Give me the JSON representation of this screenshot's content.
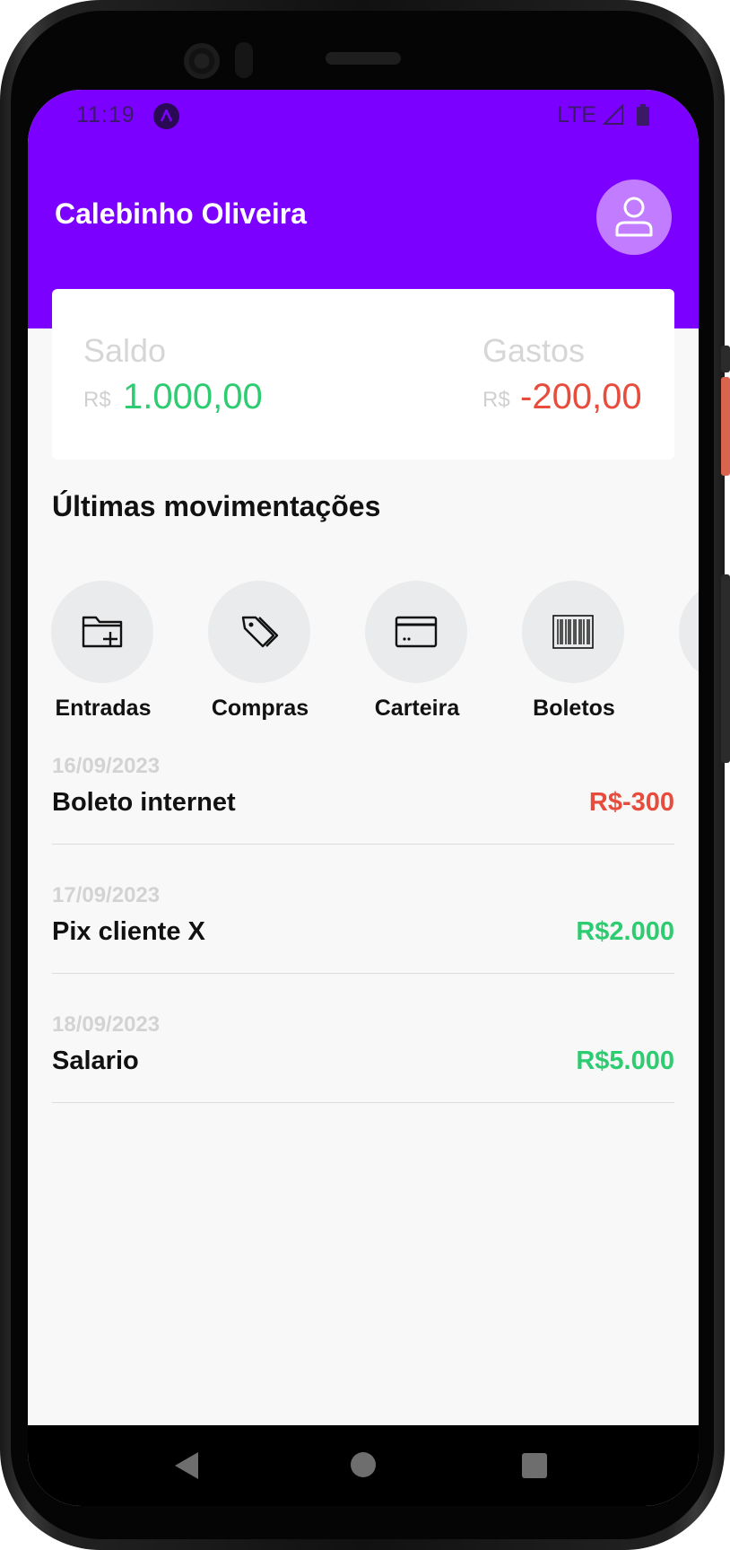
{
  "status_bar": {
    "time": "11:19",
    "network": "LTE",
    "icons": [
      "app-notification-icon",
      "signal-icon",
      "battery-icon"
    ]
  },
  "header": {
    "user_name": "Calebinho Oliveira",
    "avatar_icon": "user-icon"
  },
  "balance": {
    "saldo_label": "Saldo",
    "saldo_currency": "R$",
    "saldo_value": "1.000,00",
    "gastos_label": "Gastos",
    "gastos_currency": "R$",
    "gastos_value": "-200,00"
  },
  "section": {
    "title": "Últimas movimentações"
  },
  "actions": [
    {
      "label": "Entradas",
      "icon": "folder-add-icon"
    },
    {
      "label": "Compras",
      "icon": "tags-icon"
    },
    {
      "label": "Carteira",
      "icon": "credit-card-icon"
    },
    {
      "label": "Boletos",
      "icon": "barcode-icon"
    }
  ],
  "transactions": [
    {
      "date": "16/09/2023",
      "description": "Boleto internet",
      "amount": "R$-300"
    },
    {
      "date": "17/09/2023",
      "description": "Pix cliente X",
      "amount": "R$2.000"
    },
    {
      "date": "18/09/2023",
      "description": "Salario",
      "amount": "R$5.000"
    }
  ],
  "colors": {
    "primary": "#7b00ff",
    "avatar_bg": "#c27cff",
    "positive": "#2ecc71",
    "negative": "#e74c3c"
  }
}
